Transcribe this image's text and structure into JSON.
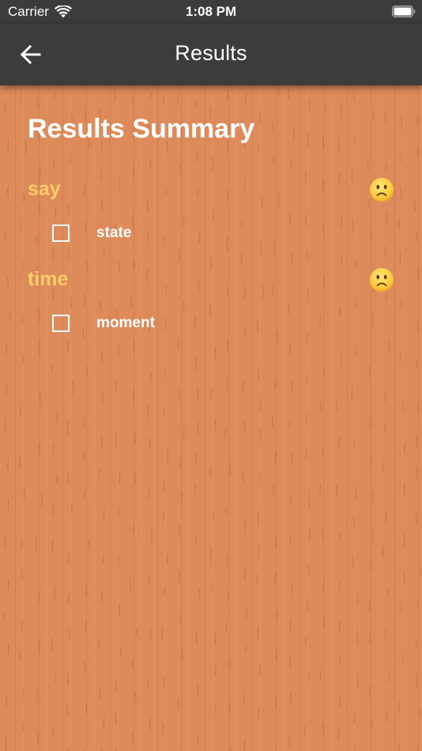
{
  "status_bar": {
    "carrier": "Carrier",
    "time": "1:08 PM"
  },
  "nav": {
    "title": "Results",
    "back_icon": "arrow-left-icon"
  },
  "main": {
    "heading": "Results Summary",
    "results": [
      {
        "word": "say",
        "status_icon": "slightly-frowning-face-icon",
        "answer": "state",
        "checked": false
      },
      {
        "word": "time",
        "status_icon": "slightly-frowning-face-icon",
        "answer": "moment",
        "checked": false
      }
    ]
  },
  "colors": {
    "bar_background": "#3c3c3c",
    "wood_background": "#de8b5c",
    "word_color": "#fccd66",
    "text_color": "#ffffff"
  }
}
